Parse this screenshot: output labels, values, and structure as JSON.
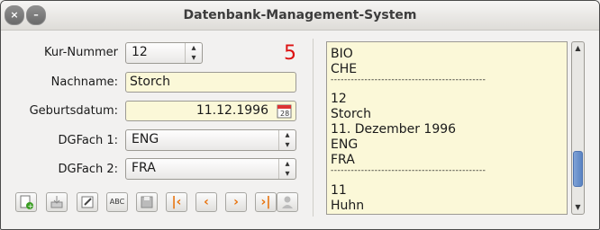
{
  "window": {
    "title": "Datenbank-Management-System",
    "close_glyph": "×",
    "minimize_glyph": "–"
  },
  "form": {
    "kur_nummer_label": "Kur-Nummer",
    "kur_nummer_value": "12",
    "count": "5",
    "nachname_label": "Nachname:",
    "nachname_value": "Storch",
    "geburtsdatum_label": "Geburtsdatum:",
    "geburtsdatum_value": "11.12.1996",
    "dgfach1_label": "DGFach 1:",
    "dgfach1_value": "ENG",
    "dgfach2_label": "DGFach 2:",
    "dgfach2_value": "FRA"
  },
  "list": {
    "lines": [
      "BIO",
      "CHE",
      "----------------------------------------------",
      "12",
      "Storch",
      "11. Dezember 1996",
      "ENG",
      "FRA",
      "----------------------------------------------",
      "11",
      "Huhn"
    ]
  },
  "toolbar": {
    "buttons": [
      "new-record-icon",
      "import-icon",
      "edit-icon",
      "spellcheck-icon",
      "save-icon",
      "first-record-icon",
      "previous-record-icon",
      "next-record-icon",
      "last-record-icon",
      "user-icon"
    ],
    "nav_glyphs": {
      "first": "|‹",
      "prev": "‹",
      "next": "›",
      "last": "›|"
    },
    "spell_label": "ABC"
  },
  "colors": {
    "count": "#dd1111",
    "nav": "#e8720c",
    "field_bg": "#fbf8d8"
  }
}
